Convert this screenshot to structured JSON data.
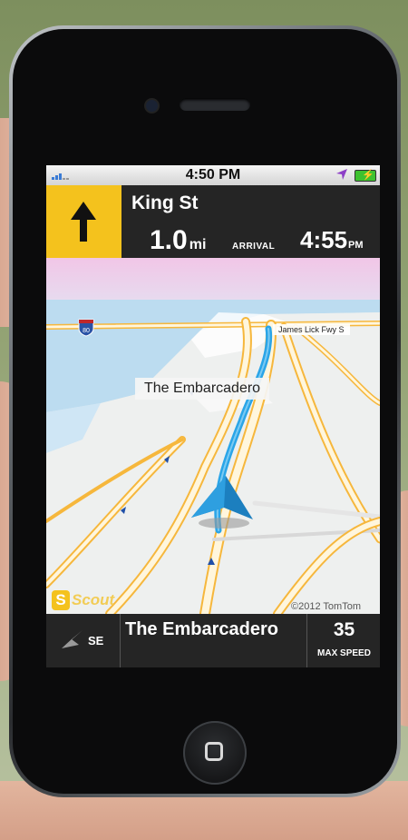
{
  "status_bar": {
    "time": "4:50 PM",
    "signal_icon": "signal-bars-icon",
    "location_icon": "location-arrow-icon",
    "battery_icon": "battery-charging-icon"
  },
  "navigation": {
    "next_street": "King St",
    "turn_icon": "straight-arrow-icon",
    "distance_value": "1.0",
    "distance_unit": "mi",
    "arrival_label": "ARRIVAL",
    "arrival_time": "4:55",
    "arrival_ampm": "PM"
  },
  "map": {
    "label_main": "The Embarcadero",
    "label_freeway": "James Lick Fwy S",
    "highway_shield": "80",
    "copyright": "©2012 TomTom",
    "logo_text": "Scout",
    "logo_badge": "S"
  },
  "bottom_bar": {
    "heading": "SE",
    "compass_icon": "compass-icon",
    "current_street": "The Embarcadero",
    "speed_limit": "35",
    "speed_label": "MAX SPEED"
  },
  "colors": {
    "accent_yellow": "#f4c21d",
    "route_blue": "#2aa5e8",
    "panel_dark": "#252525",
    "water": "#bcdcf0",
    "road_orange": "#f6b73c"
  }
}
